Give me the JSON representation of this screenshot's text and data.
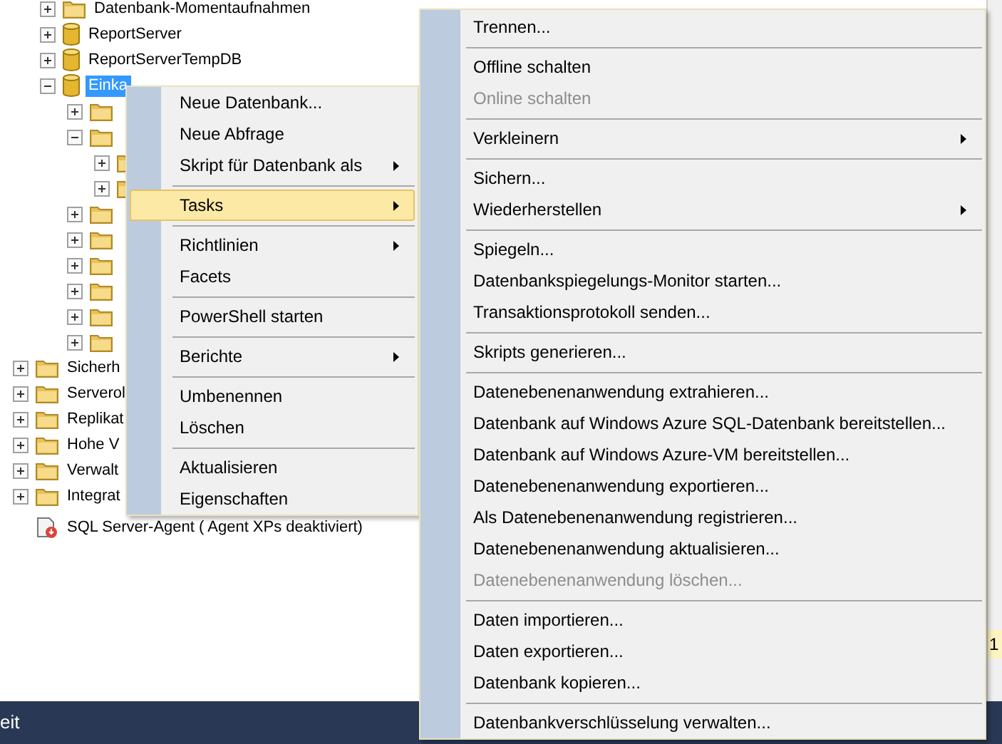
{
  "tree": {
    "items": [
      {
        "children": [
          {
            "label": "Datenbank-Momentaufnahmen",
            "kind": "folder",
            "expanded": false,
            "selected": false
          },
          {
            "label": "ReportServer",
            "kind": "database",
            "expanded": false,
            "selected": false
          },
          {
            "label": "ReportServerTempDB",
            "kind": "database",
            "expanded": false,
            "selected": false
          },
          {
            "label": "Einka",
            "kind": "database",
            "expanded": true,
            "selected": true,
            "children": [
              {
                "kind": "folder",
                "expanded": false
              },
              {
                "kind": "folder",
                "expanded": true,
                "children": [
                  {
                    "kind": "folder",
                    "expanded": false
                  },
                  {
                    "kind": "folder",
                    "expanded": false
                  }
                ]
              },
              {
                "kind": "folder",
                "expanded": false
              },
              {
                "kind": "folder",
                "expanded": false
              },
              {
                "kind": "folder",
                "expanded": false
              },
              {
                "kind": "folder",
                "expanded": false
              },
              {
                "kind": "folder",
                "expanded": false
              },
              {
                "kind": "folder",
                "expanded": false
              }
            ]
          }
        ]
      },
      {
        "label": "Sicherh",
        "kind": "folder",
        "expanded": false,
        "selected": false
      },
      {
        "label": "Serverol",
        "kind": "folder",
        "expanded": false,
        "selected": false
      },
      {
        "label": "Replikat",
        "kind": "folder",
        "expanded": false,
        "selected": false
      },
      {
        "label": "Hohe V",
        "kind": "folder",
        "expanded": false,
        "selected": false
      },
      {
        "label": "Verwalt",
        "kind": "folder",
        "expanded": false,
        "selected": false
      },
      {
        "label": "Integrat",
        "kind": "folder",
        "expanded": false,
        "selected": false
      },
      {
        "label": "SQL Server-Agent ( Agent XPs  deaktiviert)",
        "kind": "agent",
        "selected": false
      }
    ]
  },
  "status_bar": {
    "text": "eit"
  },
  "side_badge": "1",
  "context_menu": {
    "items": [
      {
        "kind": "item",
        "label": "Neue Datenbank...",
        "submenu": false,
        "disabled": false,
        "selected": false
      },
      {
        "kind": "item",
        "label": "Neue Abfrage",
        "submenu": false,
        "disabled": false,
        "selected": false
      },
      {
        "kind": "item",
        "label": "Skript für Datenbank als",
        "submenu": true,
        "disabled": false,
        "selected": false
      },
      {
        "kind": "separator"
      },
      {
        "kind": "item",
        "label": "Tasks",
        "submenu": true,
        "disabled": false,
        "selected": true
      },
      {
        "kind": "separator"
      },
      {
        "kind": "item",
        "label": "Richtlinien",
        "submenu": true,
        "disabled": false,
        "selected": false
      },
      {
        "kind": "item",
        "label": "Facets",
        "submenu": false,
        "disabled": false,
        "selected": false
      },
      {
        "kind": "separator"
      },
      {
        "kind": "item",
        "label": "PowerShell starten",
        "submenu": false,
        "disabled": false,
        "selected": false
      },
      {
        "kind": "separator"
      },
      {
        "kind": "item",
        "label": "Berichte",
        "submenu": true,
        "disabled": false,
        "selected": false
      },
      {
        "kind": "separator"
      },
      {
        "kind": "item",
        "label": "Umbenennen",
        "submenu": false,
        "disabled": false,
        "selected": false
      },
      {
        "kind": "item",
        "label": "Löschen",
        "submenu": false,
        "disabled": false,
        "selected": false
      },
      {
        "kind": "separator"
      },
      {
        "kind": "item",
        "label": "Aktualisieren",
        "submenu": false,
        "disabled": false,
        "selected": false
      },
      {
        "kind": "item",
        "label": "Eigenschaften",
        "submenu": false,
        "disabled": false,
        "selected": false
      }
    ]
  },
  "tasks_submenu": {
    "items": [
      {
        "kind": "item",
        "label": "Trennen...",
        "submenu": false,
        "disabled": false,
        "selected": false
      },
      {
        "kind": "separator"
      },
      {
        "kind": "item",
        "label": "Offline schalten",
        "submenu": false,
        "disabled": false,
        "selected": false
      },
      {
        "kind": "item",
        "label": "Online schalten",
        "submenu": false,
        "disabled": true,
        "selected": false
      },
      {
        "kind": "separator"
      },
      {
        "kind": "item",
        "label": "Verkleinern",
        "submenu": true,
        "disabled": false,
        "selected": false
      },
      {
        "kind": "separator"
      },
      {
        "kind": "item",
        "label": "Sichern...",
        "submenu": false,
        "disabled": false,
        "selected": false
      },
      {
        "kind": "item",
        "label": "Wiederherstellen",
        "submenu": true,
        "disabled": false,
        "selected": false
      },
      {
        "kind": "separator"
      },
      {
        "kind": "item",
        "label": "Spiegeln...",
        "submenu": false,
        "disabled": false,
        "selected": false
      },
      {
        "kind": "item",
        "label": "Datenbankspiegelungs-Monitor starten...",
        "submenu": false,
        "disabled": false,
        "selected": false
      },
      {
        "kind": "item",
        "label": "Transaktionsprotokoll senden...",
        "submenu": false,
        "disabled": false,
        "selected": false
      },
      {
        "kind": "separator"
      },
      {
        "kind": "item",
        "label": "Skripts generieren...",
        "submenu": false,
        "disabled": false,
        "selected": false
      },
      {
        "kind": "separator"
      },
      {
        "kind": "item",
        "label": "Datenebenenanwendung extrahieren...",
        "submenu": false,
        "disabled": false,
        "selected": false
      },
      {
        "kind": "item",
        "label": "Datenbank auf Windows Azure SQL-Datenbank bereitstellen...",
        "submenu": false,
        "disabled": false,
        "selected": false
      },
      {
        "kind": "item",
        "label": "Datenbank auf Windows Azure-VM bereitstellen...",
        "submenu": false,
        "disabled": false,
        "selected": false
      },
      {
        "kind": "item",
        "label": "Datenebenenanwendung exportieren...",
        "submenu": false,
        "disabled": false,
        "selected": false
      },
      {
        "kind": "item",
        "label": "Als Datenebenenanwendung registrieren...",
        "submenu": false,
        "disabled": false,
        "selected": false
      },
      {
        "kind": "item",
        "label": "Datenebenenanwendung aktualisieren...",
        "submenu": false,
        "disabled": false,
        "selected": false
      },
      {
        "kind": "item",
        "label": "Datenebenenanwendung löschen...",
        "submenu": false,
        "disabled": true,
        "selected": false
      },
      {
        "kind": "separator"
      },
      {
        "kind": "item",
        "label": "Daten importieren...",
        "submenu": false,
        "disabled": false,
        "selected": false
      },
      {
        "kind": "item",
        "label": "Daten exportieren...",
        "submenu": false,
        "disabled": false,
        "selected": false
      },
      {
        "kind": "item",
        "label": "Datenbank kopieren...",
        "submenu": false,
        "disabled": false,
        "selected": false
      },
      {
        "kind": "separator"
      },
      {
        "kind": "item",
        "label": "Datenbankverschlüsselung verwalten...",
        "submenu": false,
        "disabled": false,
        "selected": false
      }
    ]
  }
}
